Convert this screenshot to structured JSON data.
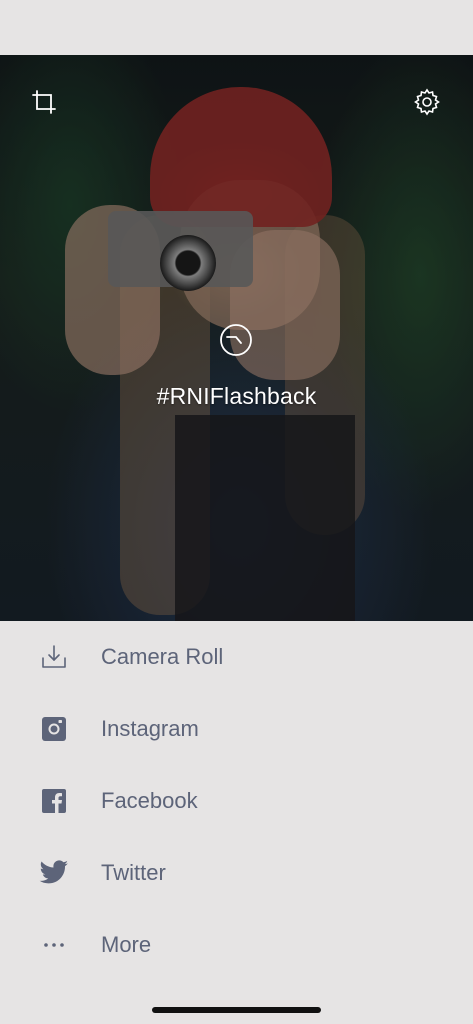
{
  "photo": {
    "hashtag": "#RNIFlashback"
  },
  "top_controls": {
    "left_icon": "crop-icon",
    "right_icon": "gear-icon"
  },
  "share": {
    "items": [
      {
        "icon": "download-icon",
        "label": "Camera Roll"
      },
      {
        "icon": "instagram-icon",
        "label": "Instagram"
      },
      {
        "icon": "facebook-icon",
        "label": "Facebook"
      },
      {
        "icon": "twitter-icon",
        "label": "Twitter"
      },
      {
        "icon": "more-dots-icon",
        "label": "More"
      }
    ]
  },
  "colors": {
    "background": "#e6e4e4",
    "label": "#5d6479",
    "icon": "#5d6479",
    "home_indicator": "#111111"
  }
}
